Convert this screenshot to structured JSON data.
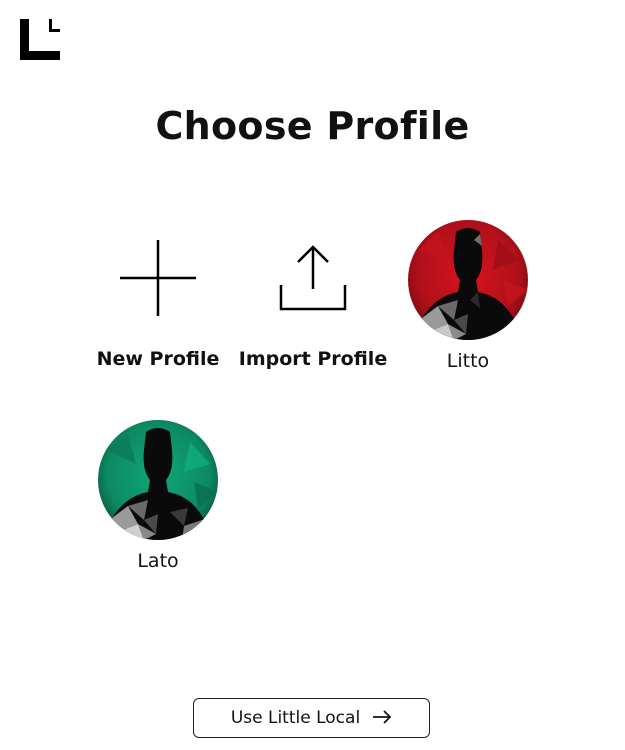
{
  "app": {
    "logo_icon": "little-local-logo-icon",
    "title": "Choose Profile"
  },
  "tiles": {
    "new_profile": {
      "label": "New Profile",
      "icon": "plus-icon"
    },
    "import_profile": {
      "label": "Import Profile",
      "icon": "upload-icon"
    }
  },
  "profiles": [
    {
      "name": "Litto",
      "avatar_color": "#b5121b"
    },
    {
      "name": "Lato",
      "avatar_color": "#0f8f6a"
    }
  ],
  "footer": {
    "button_label": "Use Little Local",
    "button_icon": "arrow-right-icon"
  }
}
